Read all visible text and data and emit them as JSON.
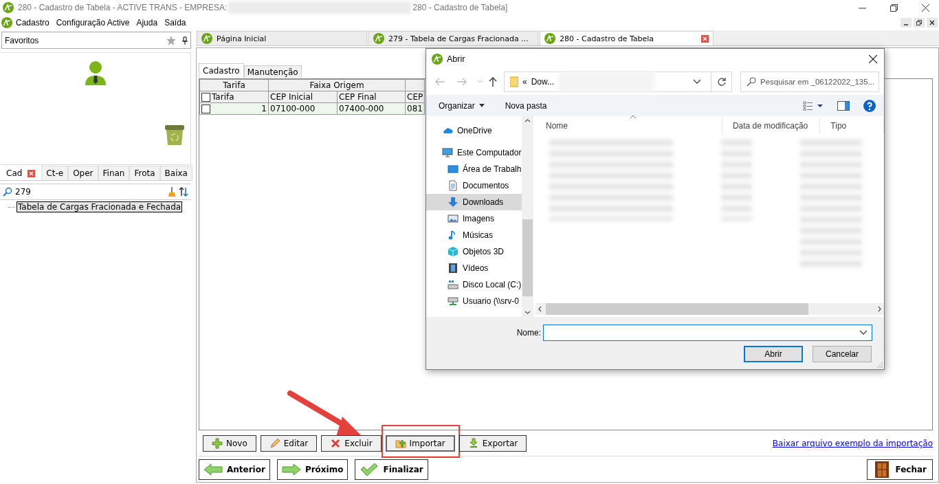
{
  "window": {
    "title": "280 - Cadastro de Tabela - ACTIVE TRANS - EMPRESA:",
    "title_end": "280 - Cadastro de Tabela]"
  },
  "menu": [
    "Cadastro",
    "Configuração Active",
    "Ajuda",
    "Saída"
  ],
  "sidebar": {
    "header": "Favoritos",
    "tabs": [
      {
        "label": "Cad",
        "selected": true,
        "closable": true
      },
      {
        "label": "Ct-e",
        "selected": false,
        "closable": false
      },
      {
        "label": "Oper",
        "selected": false,
        "closable": false
      },
      {
        "label": "Finan",
        "selected": false,
        "closable": false
      },
      {
        "label": "Frota",
        "selected": false,
        "closable": false
      },
      {
        "label": "Baixa",
        "selected": false,
        "closable": false
      }
    ],
    "search": {
      "value": "279"
    },
    "tree": [
      {
        "label": "Tabela de Cargas Fracionada e Fechada",
        "selected": true
      }
    ]
  },
  "doc_tabs": [
    {
      "label": "Página Inicial",
      "selected": false,
      "closable": false
    },
    {
      "label": "279 - Tabela de Cargas Fracionada ...",
      "selected": false,
      "closable": false
    },
    {
      "label": "280 - Cadastro de Tabela",
      "selected": true,
      "closable": true
    }
  ],
  "form": {
    "tabs": [
      {
        "label": "Cadastro",
        "selected": true
      },
      {
        "label": "Manutenção",
        "selected": false
      }
    ],
    "table": {
      "groups": [
        "Tarifa",
        "Faixa Origem"
      ],
      "header_checked": false,
      "columns": [
        "Tarifa",
        "CEP Inicial",
        "CEP Final",
        "CEP"
      ],
      "rows": [
        {
          "checked": false,
          "cells": [
            "1",
            "07100-000",
            "07400-000",
            "081"
          ]
        }
      ]
    },
    "actions": [
      {
        "label": "Novo",
        "kind": "add",
        "focused": false,
        "highlighted": false
      },
      {
        "label": "Editar",
        "kind": "edit",
        "focused": false,
        "highlighted": false
      },
      {
        "label": "Excluir",
        "kind": "delete",
        "focused": false,
        "highlighted": false
      },
      {
        "label": "Importar",
        "kind": "import",
        "focused": true,
        "highlighted": true
      },
      {
        "label": "Exportar",
        "kind": "export",
        "focused": false,
        "highlighted": false
      }
    ],
    "link": "Baixar arquivo exemplo da importação",
    "nav": [
      {
        "label": "Anterior",
        "kind": "prev"
      },
      {
        "label": "Próximo",
        "kind": "next"
      },
      {
        "label": "Finalizar",
        "kind": "finish"
      }
    ],
    "close": "Fechar"
  },
  "dialog": {
    "title": "Abrir",
    "address": {
      "prefix": "«",
      "folder": "Dow..."
    },
    "search": {
      "placeholder": "Pesquisar em _06122022_135..."
    },
    "toolbar": [
      "Organizar",
      "Nova pasta"
    ],
    "nav_pane": [
      {
        "label": "OneDrive",
        "kind": "cloud",
        "selected": false
      },
      {
        "label": "Este Computador",
        "kind": "computer",
        "selected": false,
        "children": [
          {
            "label": "Área de Trabalh",
            "kind": "desktop",
            "selected": false
          },
          {
            "label": "Documentos",
            "kind": "documents",
            "selected": false
          },
          {
            "label": "Downloads",
            "kind": "downloads",
            "selected": true
          },
          {
            "label": "Imagens",
            "kind": "pictures",
            "selected": false
          },
          {
            "label": "Músicas",
            "kind": "music",
            "selected": false
          },
          {
            "label": "Objetos 3D",
            "kind": "objects",
            "selected": false
          },
          {
            "label": "Vídeos",
            "kind": "videos",
            "selected": false
          },
          {
            "label": "Disco Local (C:)",
            "kind": "drive",
            "selected": false
          },
          {
            "label": "Usuario (\\\\srv-0",
            "kind": "network",
            "selected": false
          }
        ]
      }
    ],
    "columns": [
      "Nome",
      "Data de modificação",
      "Tipo"
    ],
    "filename_label": "Nome:",
    "buttons": [
      {
        "label": "Abrir",
        "default": true
      },
      {
        "label": "Cancelar",
        "default": false
      }
    ]
  }
}
